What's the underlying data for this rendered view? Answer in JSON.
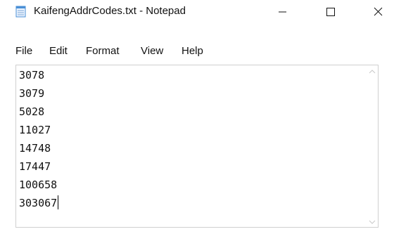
{
  "window": {
    "title": "KaifengAddrCodes.txt - Notepad",
    "icon": "notepad-icon",
    "controls": [
      "minimize-icon",
      "maximize-icon",
      "close-icon"
    ]
  },
  "menu": {
    "items": [
      "File",
      "Edit",
      "Format",
      "View",
      "Help"
    ]
  },
  "editor": {
    "lines": [
      "3078",
      "3079",
      "5028",
      "11027",
      "14748",
      "17447",
      "100658",
      "303067"
    ]
  },
  "colors": {
    "text": "#111111",
    "background": "#ffffff",
    "editor_border": "#d0d0d0",
    "icon_blue": "#4a8fd6"
  }
}
